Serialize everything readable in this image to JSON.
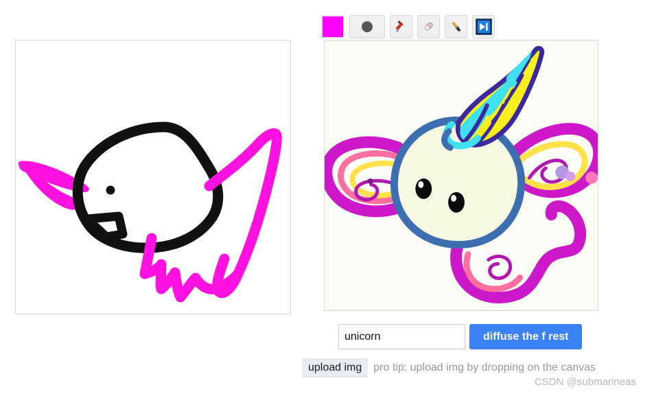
{
  "toolbar": {
    "color_swatch": {
      "name": "color-swatch",
      "value": "#ff00ff",
      "title": "color"
    },
    "items": [
      {
        "name": "brush-size-button",
        "icon": "dot-icon",
        "title": "brush size"
      },
      {
        "name": "pencil-tool-button",
        "icon": "pencil-icon",
        "title": "pencil"
      },
      {
        "name": "eraser-tool-button",
        "icon": "eraser-icon",
        "title": "eraser"
      },
      {
        "name": "paintbrush-tool-button",
        "icon": "paintbrush-icon",
        "title": "brush"
      },
      {
        "name": "step-forward-button",
        "icon": "step-forward-icon",
        "title": "play to next"
      }
    ]
  },
  "canvas_left": {
    "name": "drawing-canvas",
    "background": "#ffffff",
    "stroke_colors": {
      "black": "#111111",
      "magenta": "#ff11e0"
    },
    "description": "hand drawn doodle of a unicorn head: black head outline, black eye dot, black angular muzzle, magenta ear on the left and magenta mane and tail strokes on the right"
  },
  "canvas_right": {
    "name": "generated-image-canvas",
    "background": "#fdfdf8",
    "palette": {
      "face": "#f7f8e2",
      "face_outline": "#3d6fb0",
      "horn_yellow": "#f7ef1e",
      "horn_cyan": "#3fe0f0",
      "horn_outline": "#3b2a9c",
      "mane_magenta": "#cc18c8",
      "mane_pink": "#ff6fa0",
      "mane_yellow": "#ffe24a",
      "eye": "#0b0b0b",
      "dot_purple": "#b39ae8",
      "dot_pink": "#ff7ab8"
    },
    "description": "AI generated cartoon unicorn head with cream face, blue outline, spiral rainbow horn with yellow and cyan segments, magenta swirling mane and ears, two black eyes"
  },
  "prompt": {
    "name": "prompt-input",
    "value": "unicorn",
    "placeholder": "prompt"
  },
  "generate": {
    "name": "generate-button",
    "label": "diffuse the f rest",
    "color": "#3b82f6"
  },
  "upload": {
    "name": "upload-button",
    "label": "upload img"
  },
  "pro_tip": {
    "text": "pro tip: upload img by dropping on the canvas"
  },
  "watermark": {
    "text": "CSDN @submarineas"
  }
}
